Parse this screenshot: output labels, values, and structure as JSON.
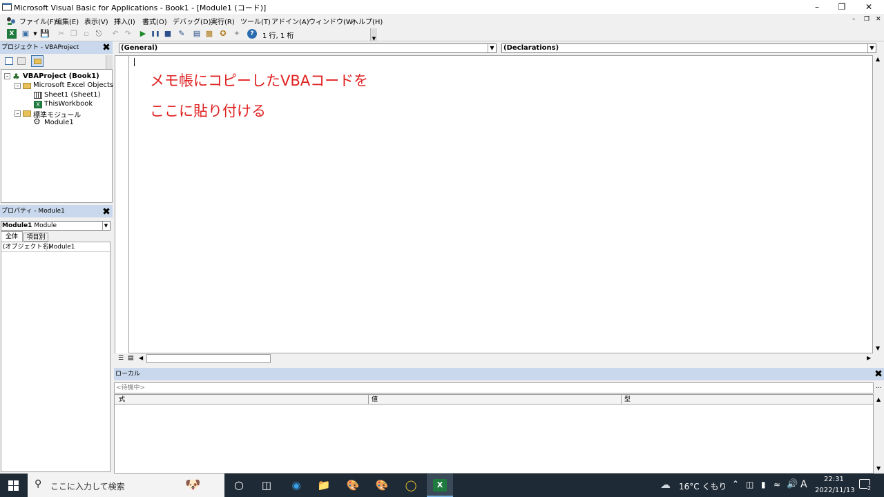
{
  "window": {
    "title": "Microsoft Visual Basic for Applications - Book1 - [Module1 (コード)]",
    "minimize_icon": "minimize-icon",
    "restore_icon": "restore-icon",
    "close_icon": "close-icon"
  },
  "menu": {
    "items": [
      "ファイル(F)",
      "編集(E)",
      "表示(V)",
      "挿入(I)",
      "書式(O)",
      "デバッグ(D)",
      "実行(R)",
      "ツール(T)",
      "アドイン(A)",
      "ウィンドウ(W)",
      "ヘルプ(H)"
    ]
  },
  "toolbar": {
    "position_text": "1 行, 1 桁"
  },
  "project_explorer": {
    "title": "プロジェクト - VBAProject",
    "root": "VBAProject (Book1)",
    "folder1": "Microsoft Excel Objects",
    "sheet1": "Sheet1 (Sheet1)",
    "workbook": "ThisWorkbook",
    "folder2": "標準モジュール",
    "module1": "Module1"
  },
  "properties": {
    "title": "プロパティ - Module1",
    "object_name": "Module1",
    "object_type": "Module",
    "tab_all": "全体",
    "tab_category": "項目別",
    "prop_name": "(オブジェクト名)",
    "prop_value": "Module1"
  },
  "code_window": {
    "object_combo": "(General)",
    "procedure_combo": "(Declarations)",
    "line1": "メモ帳にコピーしたVBAコードを",
    "line2": "ここに貼り付ける"
  },
  "locals": {
    "title": "ローカル",
    "status": "<待機中>",
    "col_expression": "式",
    "col_value": "値",
    "col_type": "型"
  },
  "taskbar": {
    "search_placeholder": "ここに入力して検索",
    "weather": "16°C くもり",
    "ime": "A",
    "time": "22:31",
    "date": "2022/11/13",
    "notification_count": "2"
  },
  "colors": {
    "annotation": "#e02020",
    "panel_header": "#c9d8ec",
    "taskbar": "#1e2a36"
  }
}
